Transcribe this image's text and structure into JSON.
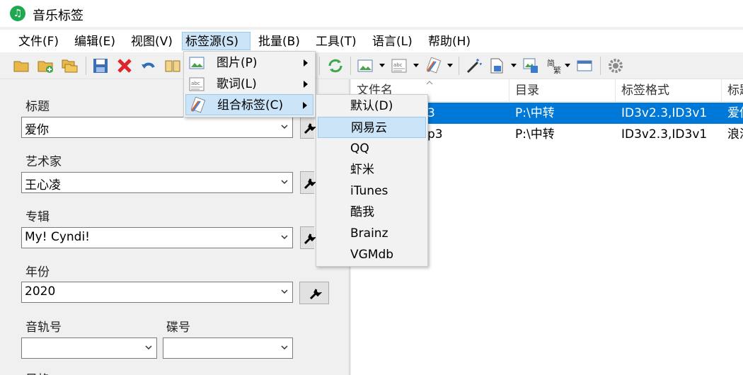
{
  "window": {
    "title": "音乐标签"
  },
  "menubar": [
    {
      "label": "文件(F)"
    },
    {
      "label": "编辑(E)"
    },
    {
      "label": "视图(V)"
    },
    {
      "label": "标签源(S)"
    },
    {
      "label": "批量(B)"
    },
    {
      "label": "工具(T)"
    },
    {
      "label": "语言(L)"
    },
    {
      "label": "帮助(H)"
    }
  ],
  "fields": {
    "title": {
      "label": "标题",
      "value": "爱你"
    },
    "artist": {
      "label": "艺术家",
      "value": "王心凌"
    },
    "album": {
      "label": "专辑",
      "value": "My! Cyndi!"
    },
    "year": {
      "label": "年份",
      "value": "2020"
    },
    "track": {
      "label": "音轨号",
      "value": ""
    },
    "disc": {
      "label": "碟号",
      "value": ""
    },
    "next_label": {
      "label": "风格"
    }
  },
  "list": {
    "columns": [
      "文件名",
      "目录",
      "标签格式",
      "标题"
    ],
    "rows": [
      {
        "filename": "3",
        "dir": "P:\\中转",
        "format": "ID3v2.3,ID3v1",
        "title": "爱你",
        "selected": true
      },
      {
        "filename": "p3",
        "dir": "P:\\中转",
        "format": "ID3v2.3,ID3v1",
        "title": "浪漫",
        "selected": false
      }
    ]
  },
  "source_menu": [
    {
      "label": "图片(P)",
      "icon": "image-icon"
    },
    {
      "label": "歌词(L)",
      "icon": "lyrics-icon"
    },
    {
      "label": "组合标签(C)",
      "icon": "combined-tags-icon"
    }
  ],
  "combined_submenu": [
    {
      "label": "默认(D)"
    },
    {
      "label": "网易云"
    },
    {
      "label": "QQ"
    },
    {
      "label": "虾米"
    },
    {
      "label": "iTunes"
    },
    {
      "label": "酷我"
    },
    {
      "label": "Brainz"
    },
    {
      "label": "VGMdb"
    }
  ],
  "colors": {
    "accent": "#0078d7",
    "menu_highlight": "#cce4f7",
    "app_icon": "#1fa84f"
  }
}
